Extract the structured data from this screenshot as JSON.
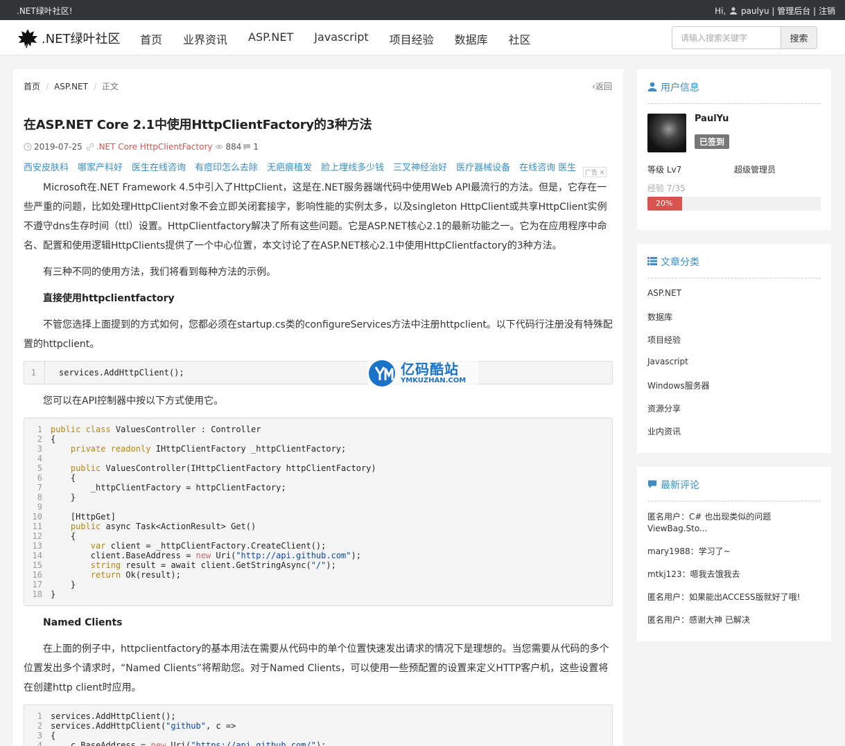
{
  "topbar": {
    "site": ".NET绿叶社区!",
    "greeting": "Hi,",
    "username": "paulyu",
    "admin": "管理后台",
    "logout": "注销",
    "sep": "|"
  },
  "nav": {
    "brand": ".NET绿叶社区",
    "items": [
      "首页",
      "业界资讯",
      "ASP.NET",
      "Javascript",
      "项目经验",
      "数据库",
      "社区"
    ],
    "search_placeholder": "请输入搜索关键字",
    "search_button": "搜索"
  },
  "article": {
    "breadcrumb": [
      "首页",
      "ASP.NET",
      "正文"
    ],
    "back": "返回",
    "title": "在ASP.NET Core 2.1中使用HttpClientFactory的3种方法",
    "date": "2019-07-25",
    "tags": ".NET Core HttpClientFactory",
    "views": "884",
    "comments": "1",
    "ad_links": [
      "西安皮肤科",
      "哪家产科好",
      "医生在线咨询",
      "有痘印怎么去除",
      "无疤痕植发",
      "脸上埋线多少钱",
      "三叉神经治好",
      "医疗器械设备",
      "在线咨询 医生"
    ],
    "ad_badge": "广告",
    "p1": "Microsoft在.NET Framework 4.5中引入了HttpClient，这是在.NET服务器端代码中使用Web API最流行的方法。但是，它存在一些严重的问题，比如处理HttpClient对象不会立即关闭套接字，影响性能的实例太多，以及singleton HttpClient或共享HttpClient实例不遵守dns生存时间（ttl）设置。HttpClientfactory解决了所有这些问题。它是ASP.NET核心2.1的最新功能之一。它为在应用程序中命名、配置和使用逻辑HttpClients提供了一个中心位置，本文讨论了在ASP.NET核心2.1中使用HttpClientfactory的3种方法。",
    "p2": "有三种不同的使用方法，我们将看到每种方法的示例。",
    "h1": "直接使用httpclientfactory",
    "p3": "不管您选择上面提到的方式如何，您都必须在startup.cs类的configureServices方法中注册httpclient。以下代码行注册没有特殊配置的httpclient。",
    "code1": "services.AddHttpClient();",
    "p4": "您可以在API控制器中按以下方式使用它。",
    "h2": "Named Clients",
    "p5": "在上面的例子中，httpclientfactory的基本用法在需要从代码中的单个位置快速发出请求的情况下是理想的。当您需要从代码的多个位置发出多个请求时，“Named Clients”将帮助您。对于Named Clients，可以使用一些预配置的设置来定义HTTP客户机，这些设置将在创建http client时应用。",
    "watermark_big": "亿码酷站",
    "watermark_small": "YMKUZHAN.COM"
  },
  "sidebar": {
    "user_title": "用户信息",
    "user_name": "PaulYu",
    "signed": "已签到",
    "level": "等级 Lv7",
    "role": "超级管理员",
    "exp": "经验 7/35",
    "progress_label": "20%",
    "progress": 0.2,
    "cat_title": "文章分类",
    "categories": [
      "ASP.NET",
      "数据库",
      "项目经验",
      "Javascript",
      "Windows服务器",
      "资源分享",
      "业内资讯"
    ],
    "cmt_title": "最新评论",
    "comments": [
      "匿名用户：C# 也出现类似的问题 ViewBag.Sto...",
      "mary1988：学习了~",
      "mtkj123：嗯我去饿我去",
      "匿名用户：如果能出ACCESS版就好了哦!",
      "匿名用户：感谢大神 已解决"
    ]
  },
  "colors": {
    "accent": "#3a8ec3",
    "danger": "#d9534f",
    "topbar": "#333639"
  }
}
